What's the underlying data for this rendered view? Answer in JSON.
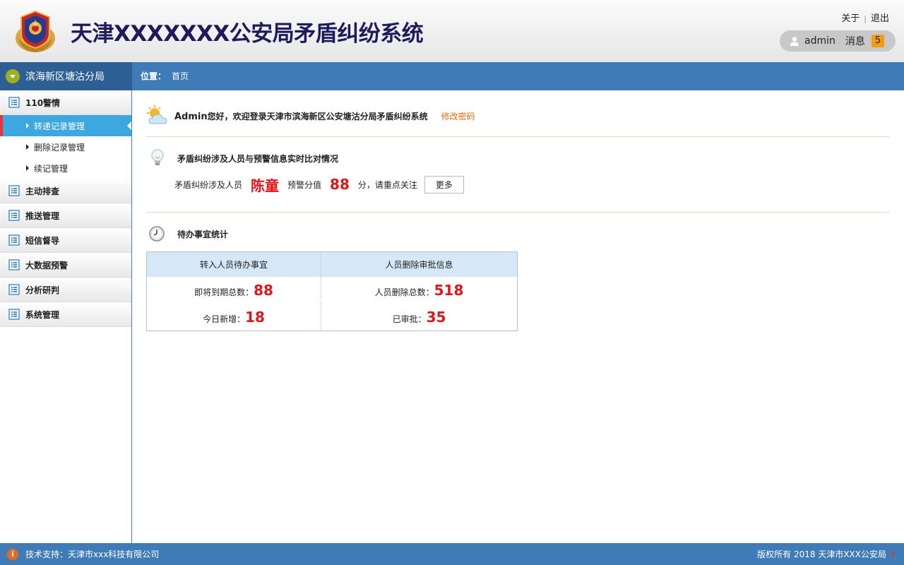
{
  "header": {
    "title": "天津XXXXXXX公安局矛盾纠纷系统",
    "about": "关于",
    "separator": "|",
    "logout": "退出",
    "user_name": "admin",
    "messages_label": "消息",
    "messages_count": "5"
  },
  "location_bar": {
    "branch": "滨海新区塘沽分局",
    "label": "位置：",
    "current": "首页"
  },
  "sidebar": {
    "groups": [
      {
        "label": "110警情",
        "items": [
          {
            "label": "转递记录管理"
          },
          {
            "label": "删除记录管理"
          },
          {
            "label": "续记管理"
          }
        ]
      },
      {
        "label": "主动排查"
      },
      {
        "label": "推送管理"
      },
      {
        "label": "短信督导"
      },
      {
        "label": "大数据预警"
      },
      {
        "label": "分析研判"
      },
      {
        "label": "系统管理"
      }
    ]
  },
  "welcome": {
    "name": "Admin",
    "text": "您好，欢迎登录天津市滨海新区公安塘沽分局矛盾纠纷系统",
    "change_password": "修改密码"
  },
  "alert": {
    "title": "矛盾纠纷涉及人员与预警信息实时比对情况",
    "person_label": "矛盾纠纷涉及人员",
    "person_name": "陈童",
    "score_label": "预警分值",
    "score": "88",
    "suffix": "分，请重点关注",
    "more_button": "更多"
  },
  "todo": {
    "title": "待办事宜统计",
    "columns": [
      "转入人员待办事宜",
      "人员删除审批信息"
    ],
    "rows": [
      [
        {
          "label": "即将到期总数：",
          "value": "88"
        },
        {
          "label": "人员删除总数：",
          "value": "518"
        }
      ],
      [
        {
          "label": "今日新增：",
          "value": "18"
        },
        {
          "label": "已审批：",
          "value": "35"
        }
      ]
    ]
  },
  "footer": {
    "support": "技术支持：天津市xxx科技有限公司",
    "copyright": "版权所有 2018 天津市XXX公安局"
  },
  "colors": {
    "header_title": "#1f1a5c",
    "bar_blue": "#3f7bb7",
    "active_item": "#3da8e0",
    "highlight_red": "#e2141a",
    "link_orange": "#e06a10",
    "badge_orange": "#f39c12"
  },
  "icons": {
    "emblem": "police-emblem-icon",
    "user": "user-icon",
    "toggle": "chevron-down-icon",
    "menu": "list-icon",
    "weather": "weather-icon",
    "bulb": "lightbulb-icon",
    "clock": "clock-icon",
    "info": "info-icon"
  }
}
